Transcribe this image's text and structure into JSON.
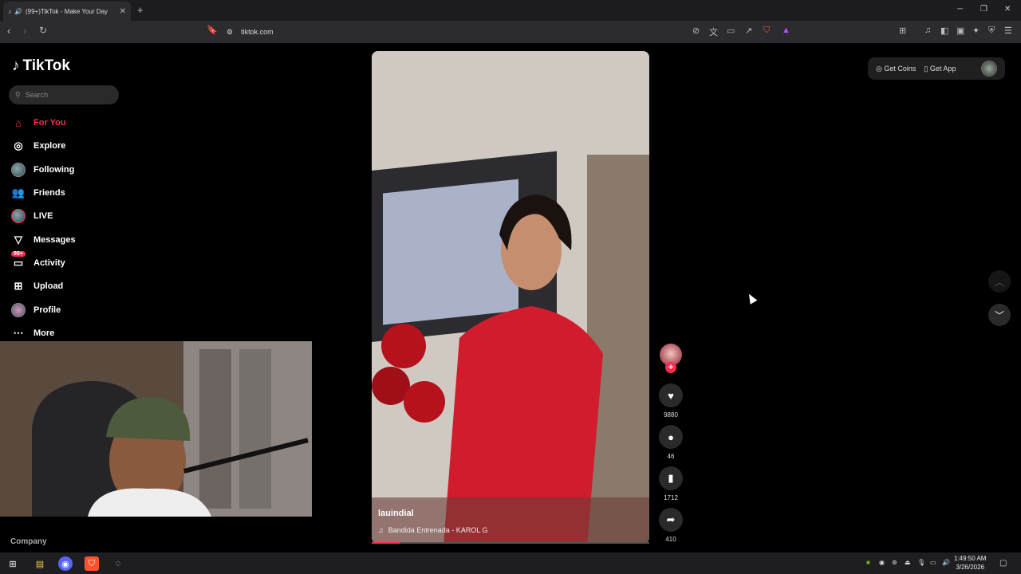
{
  "browser": {
    "tab_title": "(99+)TikTok - Make Your Day",
    "tab_audio_icon": "speaker-icon",
    "new_tab": "+",
    "url": "tiktok.com",
    "win_minimize": "─",
    "win_maximize": "❐",
    "win_close": "✕"
  },
  "sidebar": {
    "brand": "TikTok",
    "search_placeholder": "Search",
    "items": [
      {
        "label": "For You",
        "icon": "home-icon"
      },
      {
        "label": "Explore",
        "icon": "compass-icon"
      },
      {
        "label": "Following",
        "icon": "following-avatar-icon"
      },
      {
        "label": "Friends",
        "icon": "friends-icon"
      },
      {
        "label": "LIVE",
        "icon": "live-avatar-icon"
      },
      {
        "label": "Messages",
        "icon": "send-icon"
      },
      {
        "label": "Activity",
        "icon": "inbox-icon",
        "badge": "99+"
      },
      {
        "label": "Upload",
        "icon": "plus-square-icon"
      },
      {
        "label": "Profile",
        "icon": "profile-avatar-icon"
      },
      {
        "label": "More",
        "icon": "more-dots-icon"
      }
    ],
    "footer_company": "Company"
  },
  "video": {
    "username": "lauindial",
    "song": "Bandida Entrenada - KAROL G",
    "progress_percent": 10
  },
  "actions": {
    "likes": "9880",
    "comments": "46",
    "saves": "1712",
    "shares": "410"
  },
  "topbar": {
    "get_coins": "Get Coins",
    "get_app": "Get App"
  },
  "taskbar": {
    "time": "1:49:50 AM",
    "date": "3/26/2026"
  },
  "colors": {
    "accent": "#fe2c55",
    "background": "#000000",
    "chrome": "#2b2b30"
  }
}
